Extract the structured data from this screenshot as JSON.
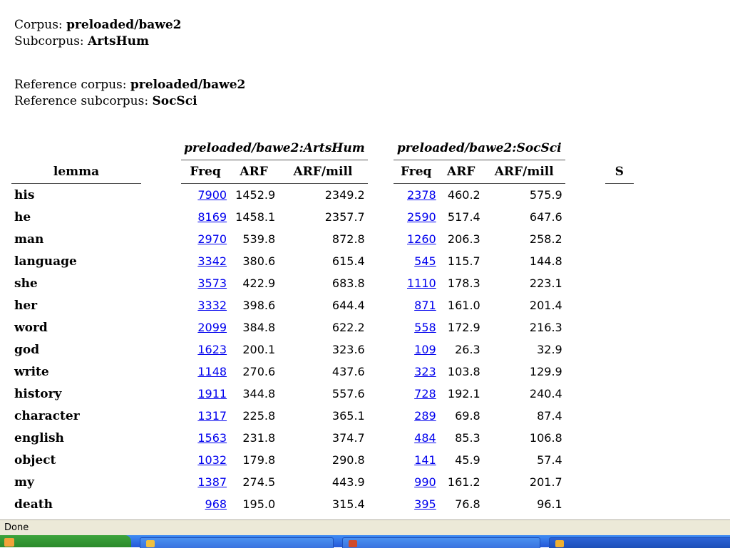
{
  "info": {
    "corpus_label": "Corpus: ",
    "corpus_value": "preloaded/bawe2",
    "subcorpus_label": "Subcorpus: ",
    "subcorpus_value": "ArtsHum",
    "ref_corpus_label": "Reference corpus: ",
    "ref_corpus_value": "preloaded/bawe2",
    "ref_subcorpus_label": "Reference subcorpus: ",
    "ref_subcorpus_value": "SocSci"
  },
  "table": {
    "group1": "preloaded/bawe2:ArtsHum",
    "group2": "preloaded/bawe2:SocSci",
    "lemma_header": "lemma",
    "freq_header": "Freq",
    "arf_header": "ARF",
    "arfmill_header": "ARF/mill",
    "cut_header": "S",
    "rows": [
      {
        "lemma": "his",
        "f1": "7900",
        "a1": "1452.9",
        "m1": "2349.2",
        "f2": "2378",
        "a2": "460.2",
        "m2": "575.9"
      },
      {
        "lemma": "he",
        "f1": "8169",
        "a1": "1458.1",
        "m1": "2357.7",
        "f2": "2590",
        "a2": "517.4",
        "m2": "647.6"
      },
      {
        "lemma": "man",
        "f1": "2970",
        "a1": "539.8",
        "m1": "872.8",
        "f2": "1260",
        "a2": "206.3",
        "m2": "258.2"
      },
      {
        "lemma": "language",
        "f1": "3342",
        "a1": "380.6",
        "m1": "615.4",
        "f2": "545",
        "a2": "115.7",
        "m2": "144.8"
      },
      {
        "lemma": "she",
        "f1": "3573",
        "a1": "422.9",
        "m1": "683.8",
        "f2": "1110",
        "a2": "178.3",
        "m2": "223.1"
      },
      {
        "lemma": "her",
        "f1": "3332",
        "a1": "398.6",
        "m1": "644.4",
        "f2": "871",
        "a2": "161.0",
        "m2": "201.4"
      },
      {
        "lemma": "word",
        "f1": "2099",
        "a1": "384.8",
        "m1": "622.2",
        "f2": "558",
        "a2": "172.9",
        "m2": "216.3"
      },
      {
        "lemma": "god",
        "f1": "1623",
        "a1": "200.1",
        "m1": "323.6",
        "f2": "109",
        "a2": "26.3",
        "m2": "32.9"
      },
      {
        "lemma": "write",
        "f1": "1148",
        "a1": "270.6",
        "m1": "437.6",
        "f2": "323",
        "a2": "103.8",
        "m2": "129.9"
      },
      {
        "lemma": "history",
        "f1": "1911",
        "a1": "344.8",
        "m1": "557.6",
        "f2": "728",
        "a2": "192.1",
        "m2": "240.4"
      },
      {
        "lemma": "character",
        "f1": "1317",
        "a1": "225.8",
        "m1": "365.1",
        "f2": "289",
        "a2": "69.8",
        "m2": "87.4"
      },
      {
        "lemma": "english",
        "f1": "1563",
        "a1": "231.8",
        "m1": "374.7",
        "f2": "484",
        "a2": "85.3",
        "m2": "106.8"
      },
      {
        "lemma": "object",
        "f1": "1032",
        "a1": "179.8",
        "m1": "290.8",
        "f2": "141",
        "a2": "45.9",
        "m2": "57.4"
      },
      {
        "lemma": "my",
        "f1": "1387",
        "a1": "274.5",
        "m1": "443.9",
        "f2": "990",
        "a2": "161.2",
        "m2": "201.7"
      },
      {
        "lemma": "death",
        "f1": "968",
        "a1": "195.0",
        "m1": "315.4",
        "f2": "395",
        "a2": "76.8",
        "m2": "96.1"
      }
    ]
  },
  "status": {
    "text": "Done"
  },
  "colors": {
    "link": "#0000ee",
    "statusbar": "#ece9d8",
    "taskbar": "#2457d8",
    "start": "#3ca43c"
  }
}
